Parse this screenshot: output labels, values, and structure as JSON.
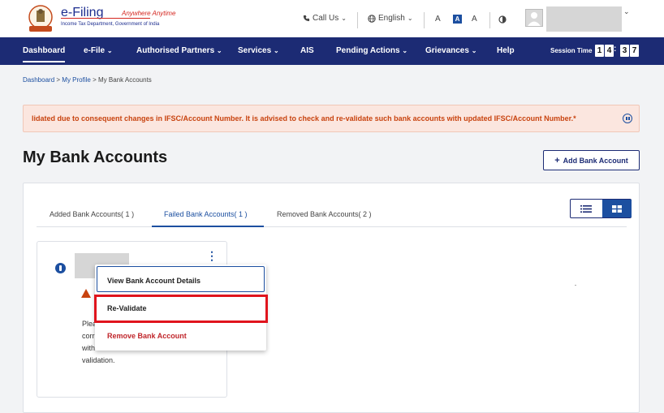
{
  "brand": {
    "title": "e-Filing",
    "tagline": "Anywhere Anytime",
    "subtitle": "Income Tax Department, Government of India"
  },
  "topbar": {
    "call_label": "Call Us",
    "language": "English",
    "font_decrease": "A",
    "font_normal": "A",
    "font_increase": "A"
  },
  "nav": {
    "items": [
      "Dashboard",
      "e-File",
      "Authorised Partners",
      "Services",
      "AIS",
      "Pending Actions",
      "Grievances",
      "Help"
    ],
    "session_label": "Session Time",
    "session_digits": [
      "1",
      "4",
      "3",
      "7"
    ],
    "session_sep": ":"
  },
  "breadcrumb": {
    "items": [
      "Dashboard",
      "My Profile",
      "My Bank Accounts"
    ],
    "separator": ">"
  },
  "alert": {
    "text": "lidated due to consequent changes in IFSC/Account Number. It is advised to check and re-validate such bank accounts with updated IFSC/Account Number.*"
  },
  "page": {
    "title": "My Bank Accounts",
    "add_button": "Add Bank Account"
  },
  "tabs": [
    {
      "label": "Added Bank Accounts( 1 )",
      "active": false
    },
    {
      "label": "Failed Bank Accounts( 1 )",
      "active": true
    },
    {
      "label": "Removed Bank Accounts( 2 )",
      "active": false
    }
  ],
  "card": {
    "text_lines": [
      "Plea",
      "corr",
      "with",
      "validation."
    ]
  },
  "menu": {
    "items": [
      "View Bank Account Details",
      "Re-Validate",
      "Remove Bank Account"
    ]
  },
  "colors": {
    "nav_bg": "#1c2b74",
    "accent": "#1c4fa0",
    "alert_bg": "#fbe6df",
    "alert_text": "#c8430f",
    "danger": "#c0262b",
    "highlight": "#e0141d"
  }
}
